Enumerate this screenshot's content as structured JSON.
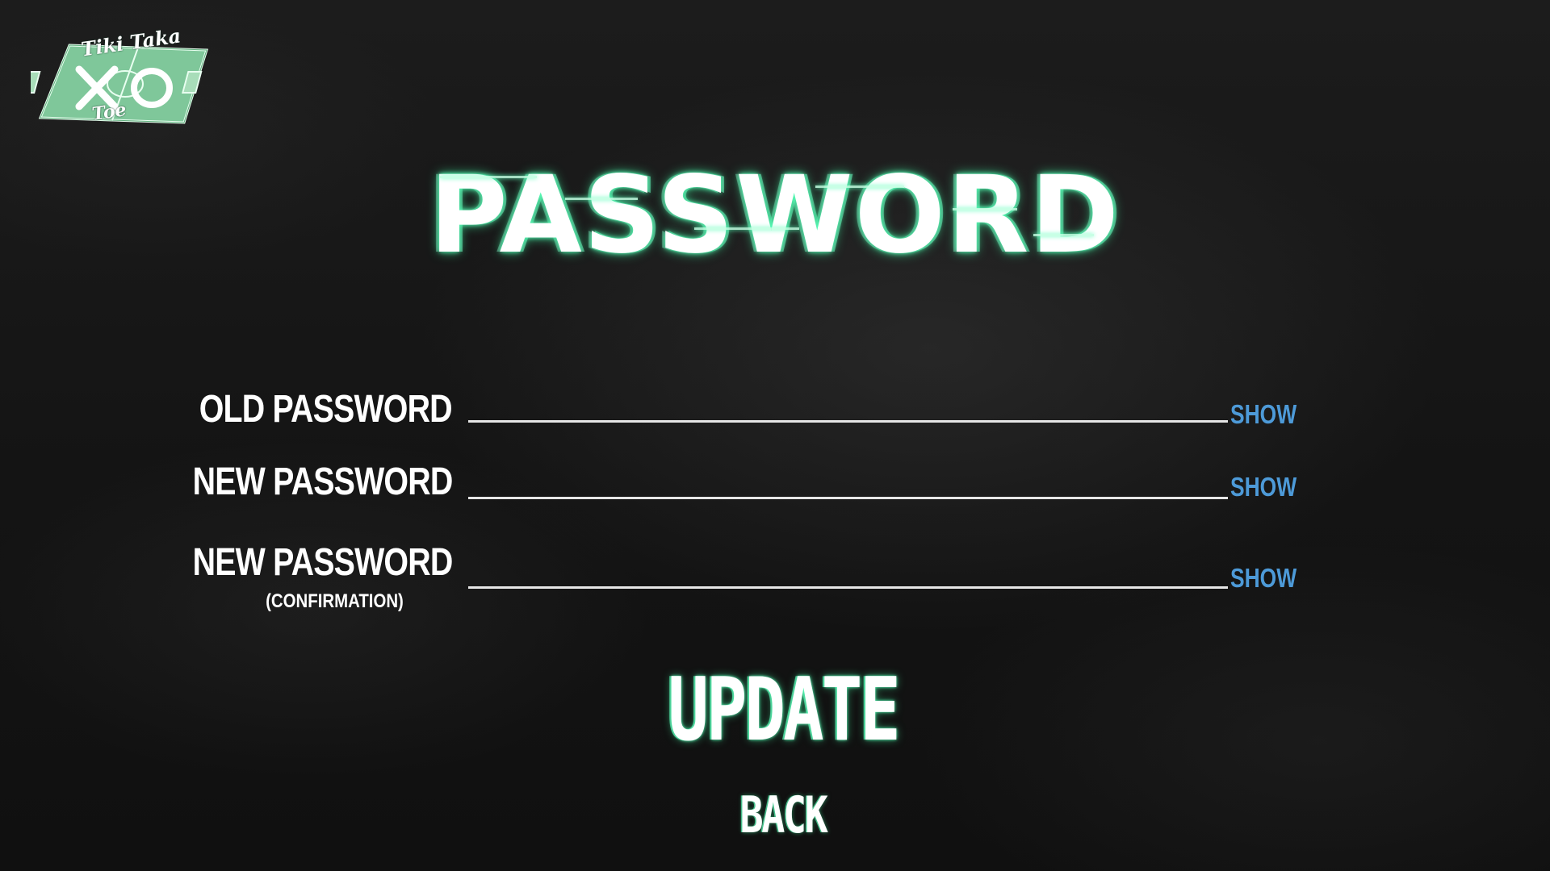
{
  "logo": {
    "line1": "Tiki Taka",
    "line2": "Toe",
    "icon": "soccer-field-xo-icon"
  },
  "title": "PASSWORD",
  "fields": [
    {
      "label": "OLD PASSWORD",
      "sublabel": "",
      "value": "",
      "show_label": "SHOW"
    },
    {
      "label": "NEW PASSWORD",
      "sublabel": "",
      "value": "",
      "show_label": "SHOW"
    },
    {
      "label": "NEW PASSWORD",
      "sublabel": "(CONFIRMATION)",
      "value": "",
      "show_label": "SHOW"
    }
  ],
  "buttons": {
    "update": "UPDATE",
    "back": "BACK"
  },
  "colors": {
    "accent_glow": "#5dffbc",
    "show_link": "#4d9ad8",
    "field_green": "#7fc79a",
    "background": "#141414"
  }
}
